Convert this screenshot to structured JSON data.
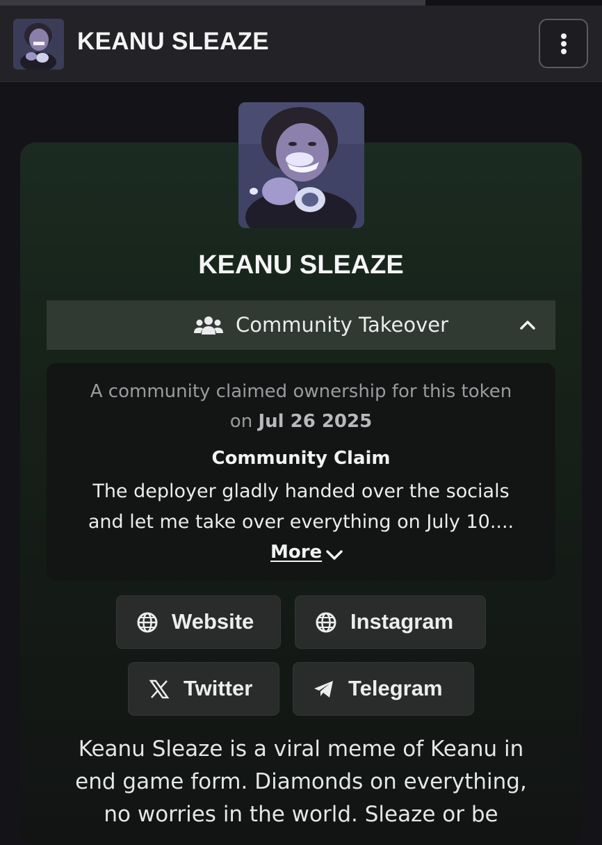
{
  "header": {
    "title": "KEANU SLEAZE",
    "avatar_icon": "token-avatar-image",
    "menu_icon": "vertical-dots-icon"
  },
  "token": {
    "name": "KEANU SLEAZE"
  },
  "community_takeover": {
    "label": "Community Takeover",
    "icon": "users-icon",
    "expanded": true,
    "claim_intro_part1": "A community claimed ownership for this token",
    "claim_intro_part2": "on",
    "claim_date": "Jul 26 2025",
    "claim_heading": "Community Claim",
    "claim_text_line1": "The deployer gladly handed over the socials",
    "claim_text_line2": "and let me take over everything on July 10....",
    "more_label": "More"
  },
  "socials": [
    {
      "label": "Website",
      "icon": "globe-icon"
    },
    {
      "label": "Instagram",
      "icon": "globe-icon"
    },
    {
      "label": "Twitter",
      "icon": "x-logo-icon"
    },
    {
      "label": "Telegram",
      "icon": "telegram-icon"
    }
  ],
  "description": {
    "line1": "Keanu Sleaze is a viral meme of Keanu in",
    "line2": "end game form. Diamonds on everything,",
    "line3": "no worries in the world. Sleaze or be"
  },
  "colors": {
    "background": "#141418",
    "card_green": "#1b2b21",
    "cto_bar": "#303a33",
    "button": "#2a2c2b"
  }
}
